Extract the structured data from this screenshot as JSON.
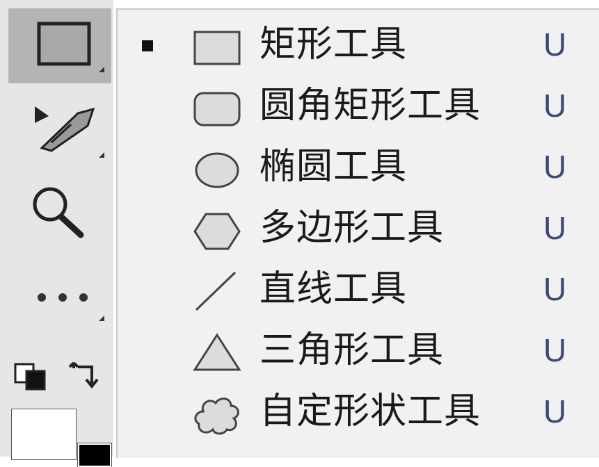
{
  "menu": {
    "items": [
      {
        "label": "矩形工具",
        "shortcut": "U",
        "icon": "rectangle-icon",
        "checked": true
      },
      {
        "label": "圆角矩形工具",
        "shortcut": "U",
        "icon": "rounded-rectangle-icon",
        "checked": false
      },
      {
        "label": "椭圆工具",
        "shortcut": "U",
        "icon": "ellipse-icon",
        "checked": false
      },
      {
        "label": "多边形工具",
        "shortcut": "U",
        "icon": "polygon-icon",
        "checked": false
      },
      {
        "label": "直线工具",
        "shortcut": "U",
        "icon": "line-icon",
        "checked": false
      },
      {
        "label": "三角形工具",
        "shortcut": "U",
        "icon": "triangle-icon",
        "checked": false
      },
      {
        "label": "自定形状工具",
        "shortcut": "U",
        "icon": "custom-shape-icon",
        "checked": false
      }
    ]
  },
  "toolbar": {
    "tools": [
      "rectangle-tool-icon",
      "pen-tool-icon",
      "zoom-tool-icon",
      "more-tools-icon"
    ],
    "active_tool": "rectangle-tool-icon"
  },
  "colors": {
    "foreground": "#ffffff",
    "background": "#000000",
    "toolbar_bg": "#e6e6e6",
    "menu_bg": "#f1f1f1",
    "active_tool_bg": "#b4b4b4",
    "shortcut_text": "#3c4a78"
  }
}
